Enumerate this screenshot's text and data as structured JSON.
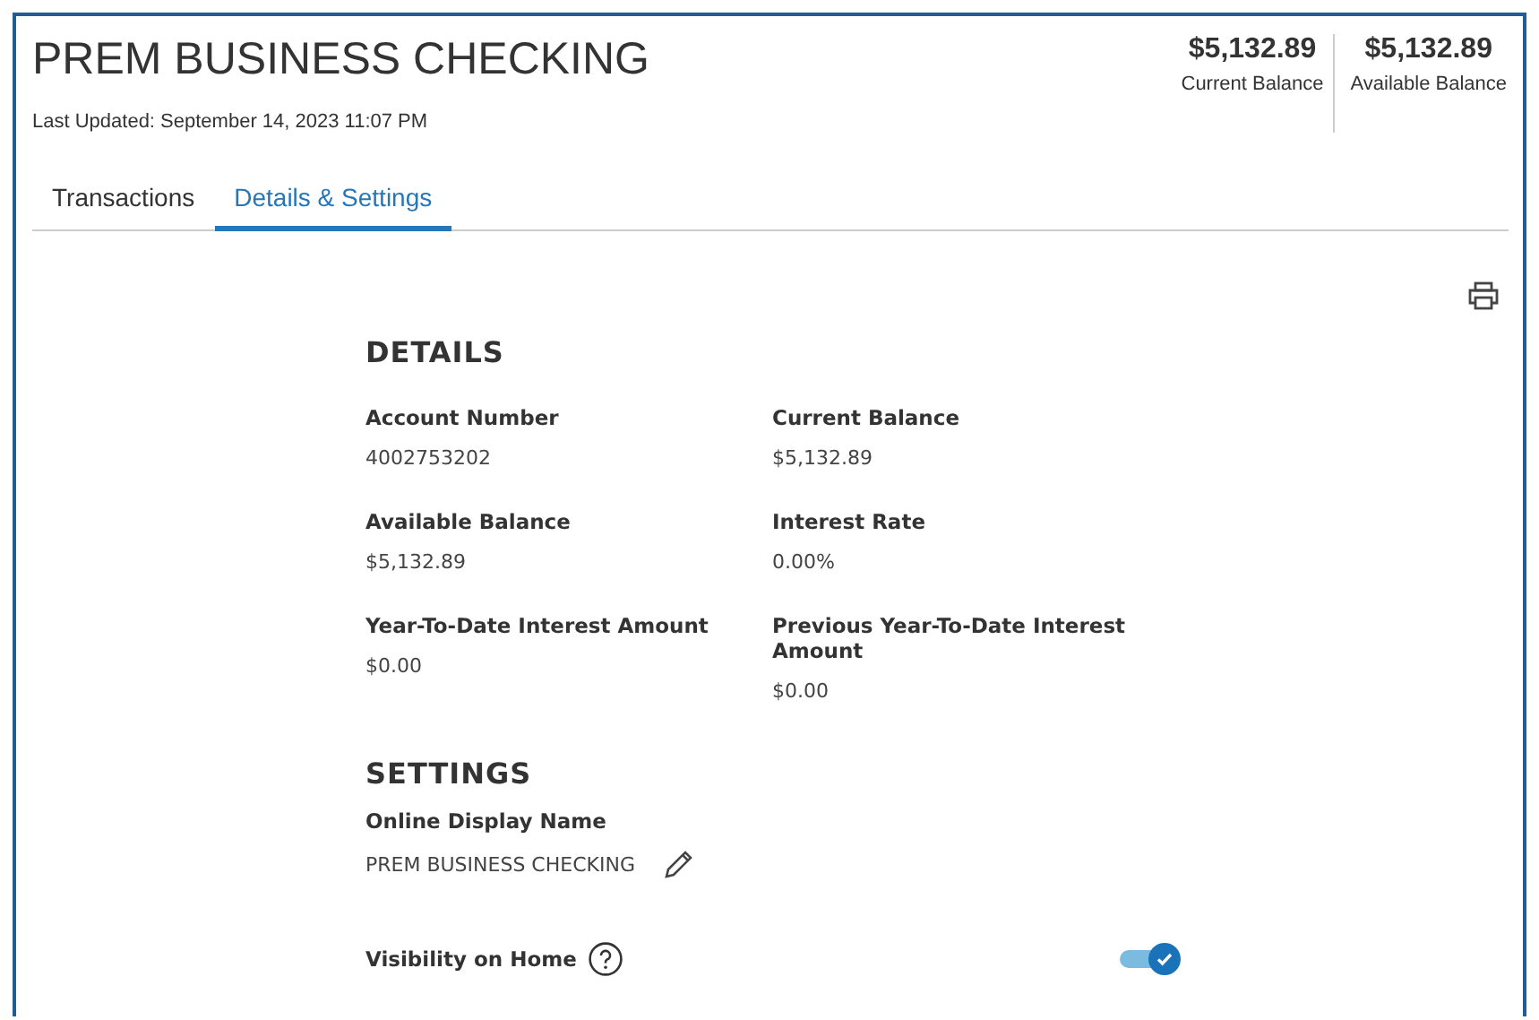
{
  "account": {
    "title": "PREM BUSINESS CHECKING",
    "last_updated": "Last Updated: September 14, 2023 11:07 PM"
  },
  "balances": [
    {
      "amount": "$5,132.89",
      "label": "Current Balance"
    },
    {
      "amount": "$5,132.89",
      "label": "Available Balance"
    }
  ],
  "tabs": [
    {
      "label": "Transactions",
      "selected": false
    },
    {
      "label": "Details & Settings",
      "selected": true
    }
  ],
  "details": {
    "heading": "DETAILS",
    "fields": [
      {
        "label": "Account Number",
        "value": "4002753202"
      },
      {
        "label": "Current Balance",
        "value": "$5,132.89"
      },
      {
        "label": "Available Balance",
        "value": "$5,132.89"
      },
      {
        "label": "Interest Rate",
        "value": "0.00%"
      },
      {
        "label": "Year-To-Date Interest Amount",
        "value": "$0.00"
      },
      {
        "label": "Previous Year-To-Date Interest Amount",
        "value": "$0.00"
      }
    ]
  },
  "settings": {
    "heading": "SETTINGS",
    "display_name_label": "Online Display Name",
    "display_name": "PREM BUSINESS CHECKING",
    "visibility_label": "Visibility on Home",
    "visibility_on": true
  }
}
